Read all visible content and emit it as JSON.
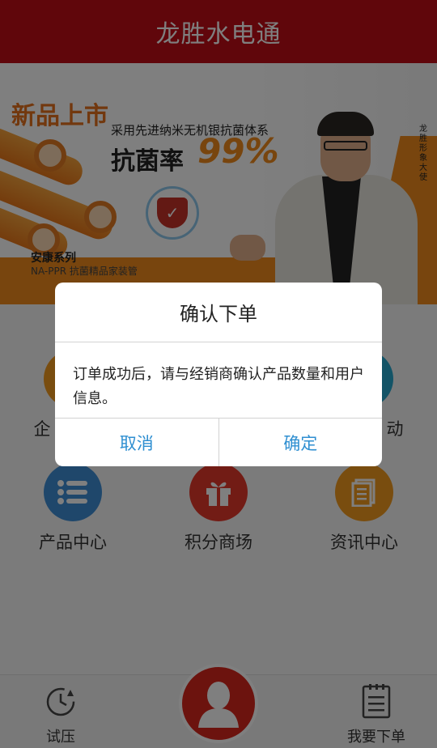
{
  "header": {
    "title": "龙胜水电通"
  },
  "banner": {
    "badge": "新品上市",
    "tagline": "采用先进纳米无机银抗菌体系",
    "rate_label": "抗菌率",
    "rate_value": "99%",
    "series_name": "安康系列",
    "series_sub": "NA-PPR 抗菌精品家装管",
    "ambassador": "龙胜形象大使"
  },
  "menu": {
    "row1": [
      {
        "label": "企",
        "color": "#f39a1e"
      },
      {
        "label": "",
        "color": "#2f8fd1"
      },
      {
        "label": "动",
        "color": "#27a8cf"
      }
    ],
    "row2": [
      {
        "label": "产品中心",
        "color": "#3f8fd6",
        "icon": "list-icon"
      },
      {
        "label": "积分商场",
        "color": "#e5382b",
        "icon": "gift-icon"
      },
      {
        "label": "资讯中心",
        "color": "#f39a1e",
        "icon": "news-icon"
      }
    ]
  },
  "bottom_nav": {
    "left_label": "试压",
    "right_label": "我要下单",
    "center_icon": "user-icon"
  },
  "dialog": {
    "title": "确认下单",
    "message": "订单成功后，请与经销商确认产品数量和用户信息。",
    "cancel": "取消",
    "confirm": "确定"
  }
}
